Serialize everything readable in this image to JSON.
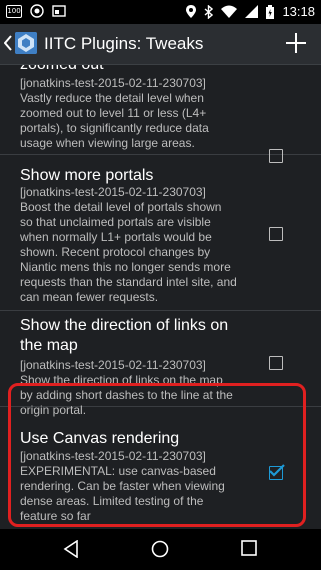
{
  "status_bar": {
    "badge_left": "100",
    "time": "13:18",
    "icons": [
      "notification-icon",
      "android-icon",
      "gallery-icon",
      "location-icon",
      "bluetooth-icon",
      "wifi-icon",
      "signal-icon",
      "battery-icon"
    ]
  },
  "action_bar": {
    "title": "IITC Plugins: Tweaks",
    "icons": [
      "back-chevron-icon",
      "iitc-logo-icon",
      "add-icon"
    ]
  },
  "plugins": [
    {
      "title": "zoomed out",
      "description": "[jonatkins-test-2015-02-11-230703]\nVastly reduce the detail level when\nzoomed out to level 11 or less (L4+\nportals), to significantly reduce data\nusage when viewing large areas.",
      "checked": false
    },
    {
      "title": "Show more portals",
      "description": "[jonatkins-test-2015-02-11-230703]\nBoost the detail level of portals shown\nso that unclaimed portals are visible\nwhen normally L1+ portals would be\nshown. Recent protocol changes by\nNiantic mens this no longer sends more\nrequests than the standard intel site, and\ncan mean fewer requests.",
      "checked": false
    },
    {
      "title": "Show the direction of links on the map",
      "description": "[jonatkins-test-2015-02-11-230703]\nShow the direction of links on the map\nby adding short dashes to the line at the\norigin portal.",
      "checked": false
    },
    {
      "title": "Use Canvas rendering",
      "description": "[jonatkins-test-2015-02-11-230703]\nEXPERIMENTAL: use canvas-based\nrendering. Can be faster when viewing\ndense areas. Limited testing of the\nfeature so far",
      "checked": true
    }
  ],
  "nav_bar": {
    "icons": [
      "back-triangle-icon",
      "home-circle-icon",
      "recents-square-icon"
    ]
  },
  "colors": {
    "background": "#1e2023",
    "action_bar": "#2b2e32",
    "checkbox_accent": "#1e9ad6",
    "highlight": "#e02020"
  }
}
